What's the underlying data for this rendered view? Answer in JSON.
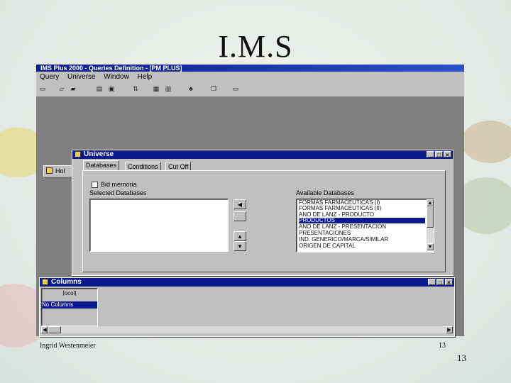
{
  "slide": {
    "title": "I.M.S",
    "author": "Ingrid Westenmeier",
    "page_inner": "13",
    "page_outer": "13"
  },
  "app": {
    "title": "IMS Plus 2000 - Queries Definition - [PM PLUS]",
    "menu": [
      "Query",
      "Universe",
      "Window",
      "Help"
    ],
    "toolbar_icons": [
      "new-icon",
      "open-icon",
      "folder-icon",
      "print-icon",
      "preview-icon",
      "sort-icon",
      "table-icon",
      "grid-icon",
      "chart-icon",
      "copy-icon",
      "window-icon"
    ]
  },
  "hol_window": {
    "title": "Hol"
  },
  "universe": {
    "title": "Universe",
    "tabs": [
      "Databases",
      "Conditions",
      "Cut Off"
    ],
    "checkbox_label": "Bid memoria",
    "selected_label": "Selected Databases",
    "available_label": "Available Databases",
    "selected_items": [],
    "available_items": [
      "FORMAS FARMACEUTICAS (I)",
      "FORMAS FARMACEUTICAS (II)",
      "AÑO DE LANZ - PRODUCTO",
      "PRODUCTOS",
      "AÑO DE LANZ - PRESENTACION",
      "PRESENTACIONES",
      "IND. GENERICO/MARCA/SIMILAR",
      "ORIGEN DE CAPITAL"
    ],
    "selected_index": 3
  },
  "columns_window": {
    "title": "Columns",
    "items": [
      "[ocol]",
      "No Columns"
    ]
  },
  "colors": {
    "titlebar": "#0a1a8c",
    "chrome": "#c0c0c0",
    "workspace": "#808080"
  }
}
